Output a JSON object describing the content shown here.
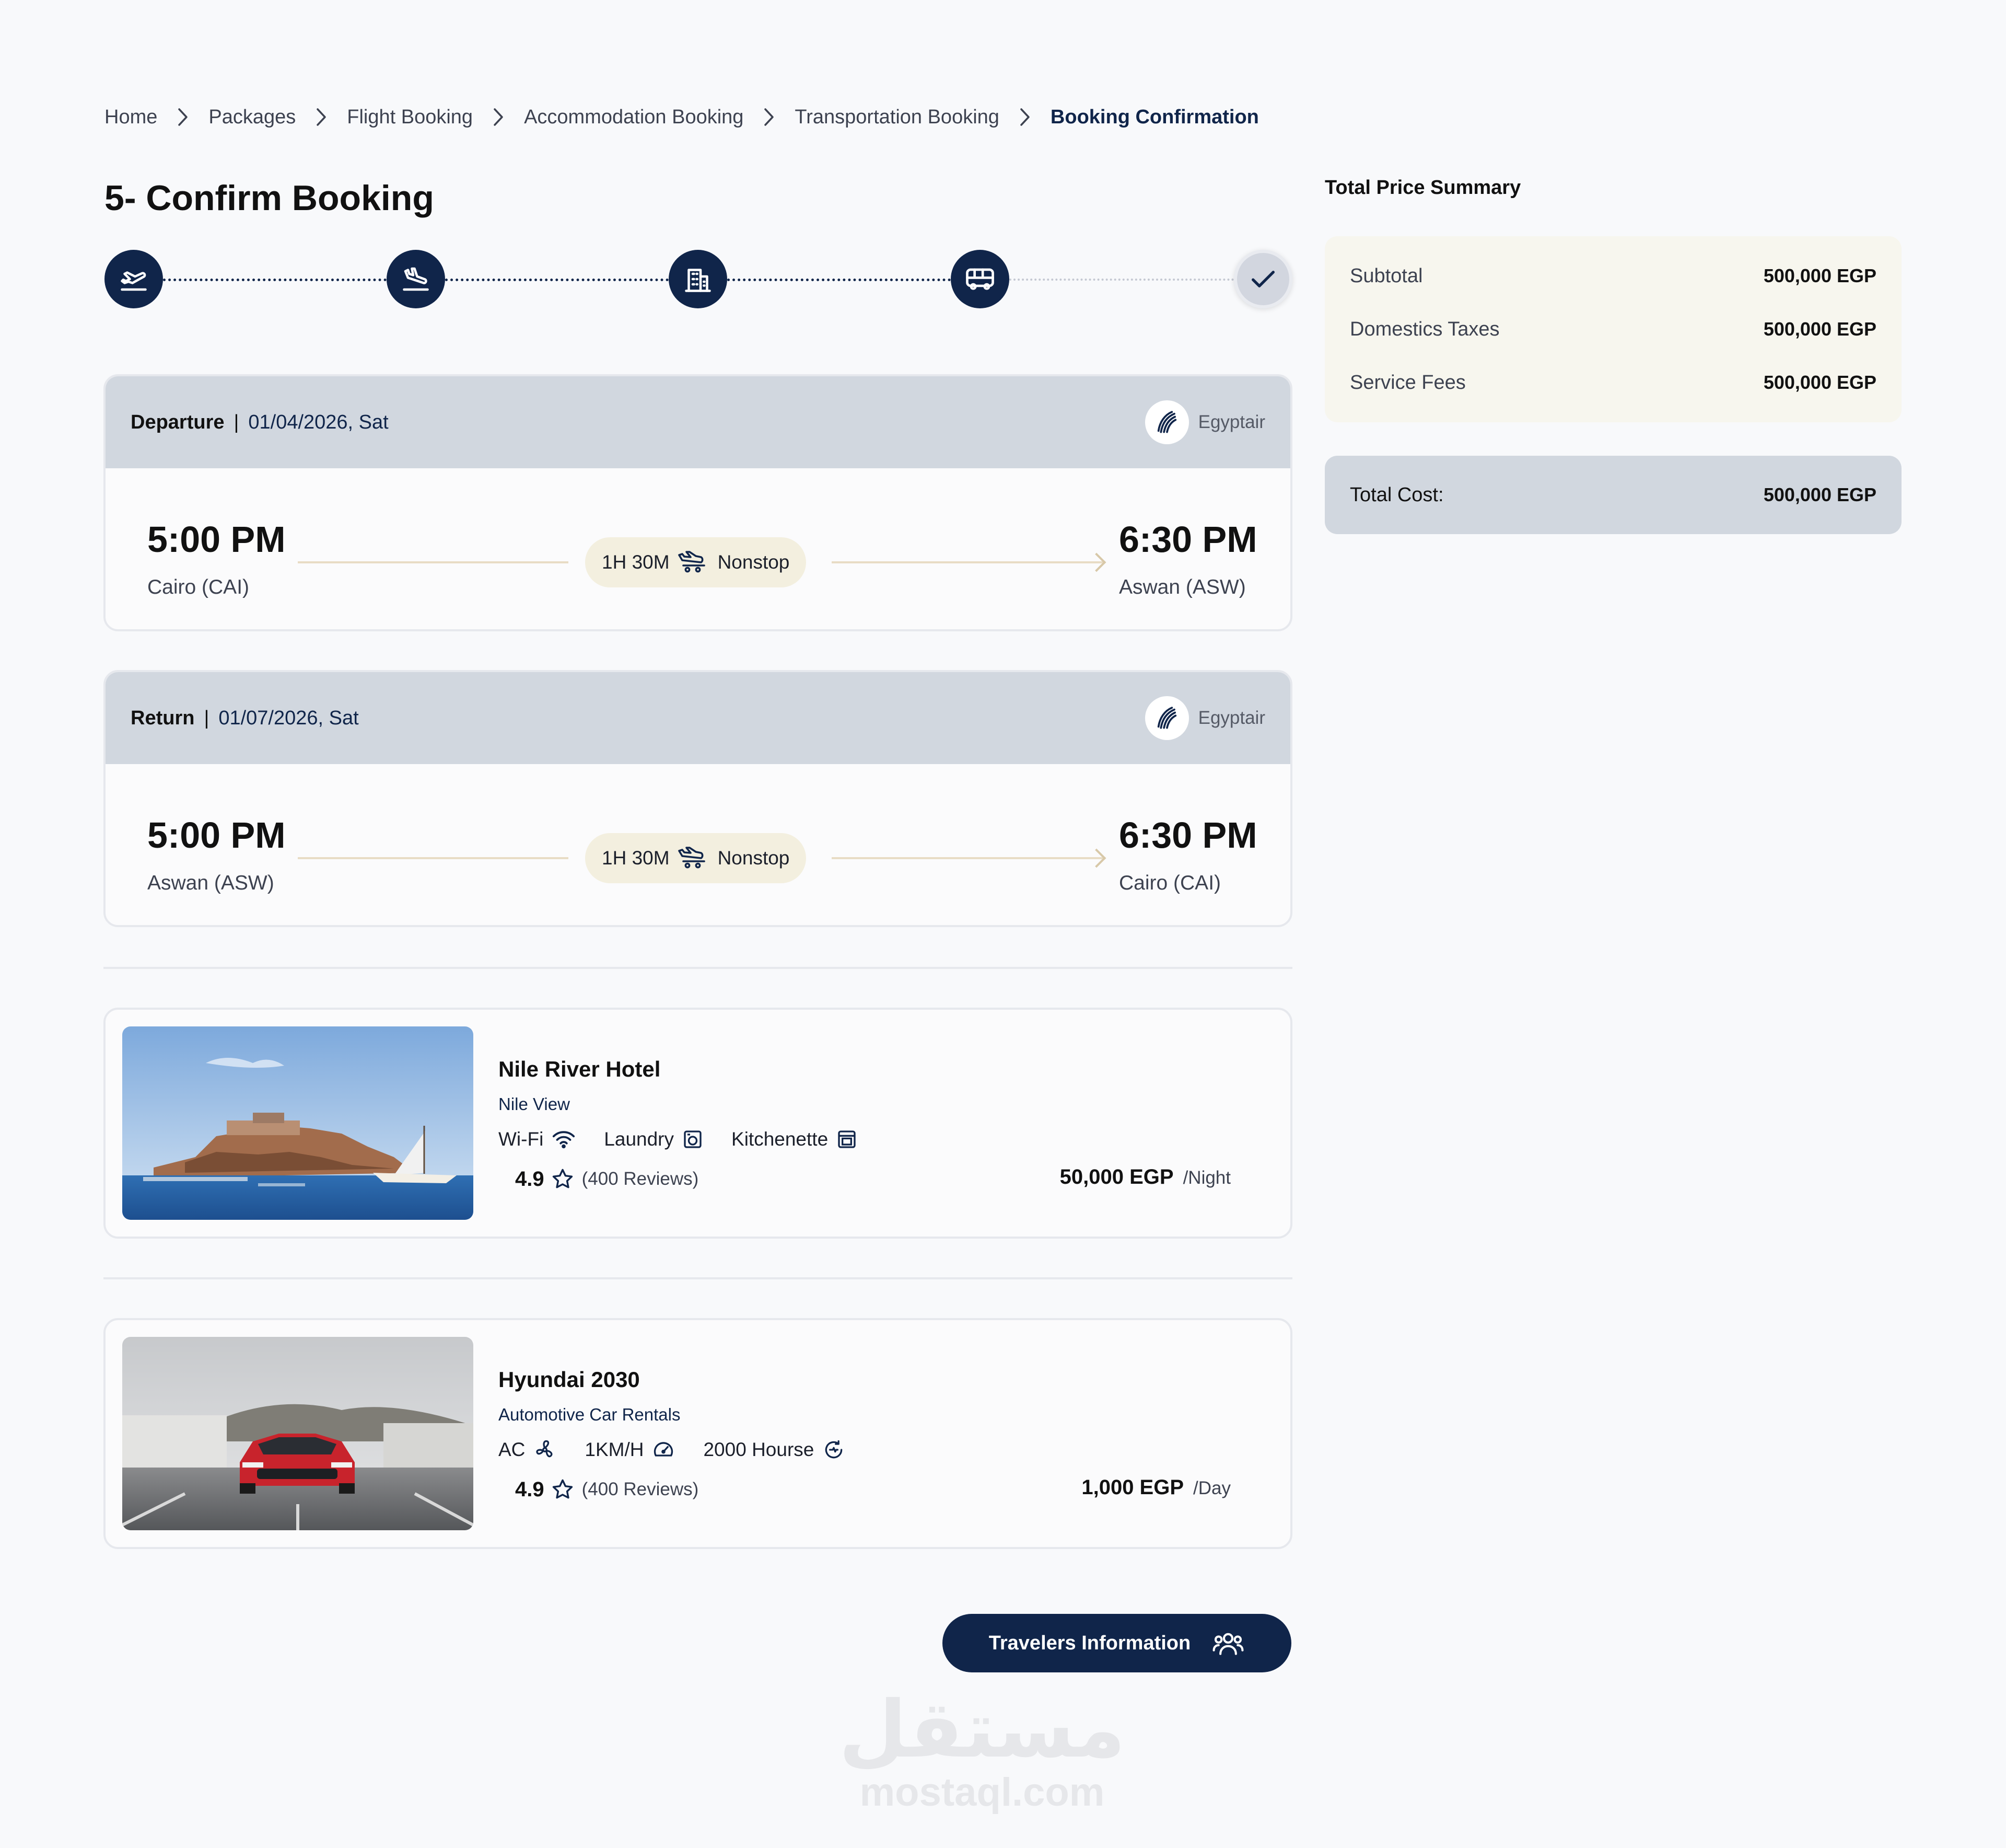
{
  "breadcrumb": {
    "items": [
      "Home",
      "Packages",
      "Flight Booking",
      "Accommodation Booking",
      "Transportation Booking",
      "Booking Confirmation"
    ]
  },
  "page": {
    "title": "5- Confirm Booking"
  },
  "stepper": {
    "steps": [
      {
        "icon": "plane-takeoff-icon",
        "state": "completed"
      },
      {
        "icon": "plane-landing-icon",
        "state": "completed"
      },
      {
        "icon": "hotel-building-icon",
        "state": "completed"
      },
      {
        "icon": "bus-icon",
        "state": "completed"
      },
      {
        "icon": "check-icon",
        "state": "current"
      }
    ]
  },
  "flights": {
    "departure": {
      "label": "Departure",
      "separator": "|",
      "date": "01/04/2026, Sat",
      "airline": "Egyptair",
      "depart_time": "5:00 PM",
      "depart_city": "Cairo (CAI)",
      "duration": "1H 30M",
      "stops": "Nonstop",
      "arrive_time": "6:30 PM",
      "arrive_city": "Aswan (ASW)"
    },
    "return": {
      "label": "Return",
      "separator": "|",
      "date": "01/07/2026, Sat",
      "airline": "Egyptair",
      "depart_time": "5:00 PM",
      "depart_city": "Aswan (ASW)",
      "duration": "1H 30M",
      "stops": "Nonstop",
      "arrive_time": "6:30 PM",
      "arrive_city": "Cairo (CAI)"
    }
  },
  "hotel": {
    "name": "Nile River Hotel",
    "subtitle": "Nile View",
    "features": [
      {
        "label": "Wi-Fi",
        "icon": "wifi-icon"
      },
      {
        "label": "Laundry",
        "icon": "washing-machine-icon"
      },
      {
        "label": "Kitchenette",
        "icon": "oven-icon"
      }
    ],
    "rating": "4.9",
    "reviews": "(400 Reviews)",
    "price": "50,000 EGP",
    "unit": "/Night"
  },
  "car": {
    "name": "Hyundai 2030",
    "subtitle": "Automotive Car Rentals",
    "features": [
      {
        "label": "AC",
        "icon": "fan-icon"
      },
      {
        "label": "1KM/H",
        "icon": "speedometer-icon"
      },
      {
        "label": "2000 Hourse",
        "icon": "engine-icon"
      }
    ],
    "rating": "4.9",
    "reviews": "(400 Reviews)",
    "price": "1,000 EGP",
    "unit": "/Day"
  },
  "summary": {
    "title": "Total Price Summary",
    "rows": [
      {
        "label": "Subtotal",
        "value": "500,000 EGP"
      },
      {
        "label": "Domestics Taxes",
        "value": "500,000 EGP"
      },
      {
        "label": "Service Fees",
        "value": "500,000 EGP"
      }
    ],
    "total_label": "Total Cost:",
    "total_value": "500,000 EGP"
  },
  "cta": {
    "label": "Travelers Information"
  },
  "watermark": {
    "arabic": "مستقل",
    "latin": "mostaql.com"
  },
  "colors": {
    "primary": "#10254a",
    "header_gray": "#d1d7df",
    "cream": "#f7f6ee",
    "pill": "#f3efdf"
  }
}
